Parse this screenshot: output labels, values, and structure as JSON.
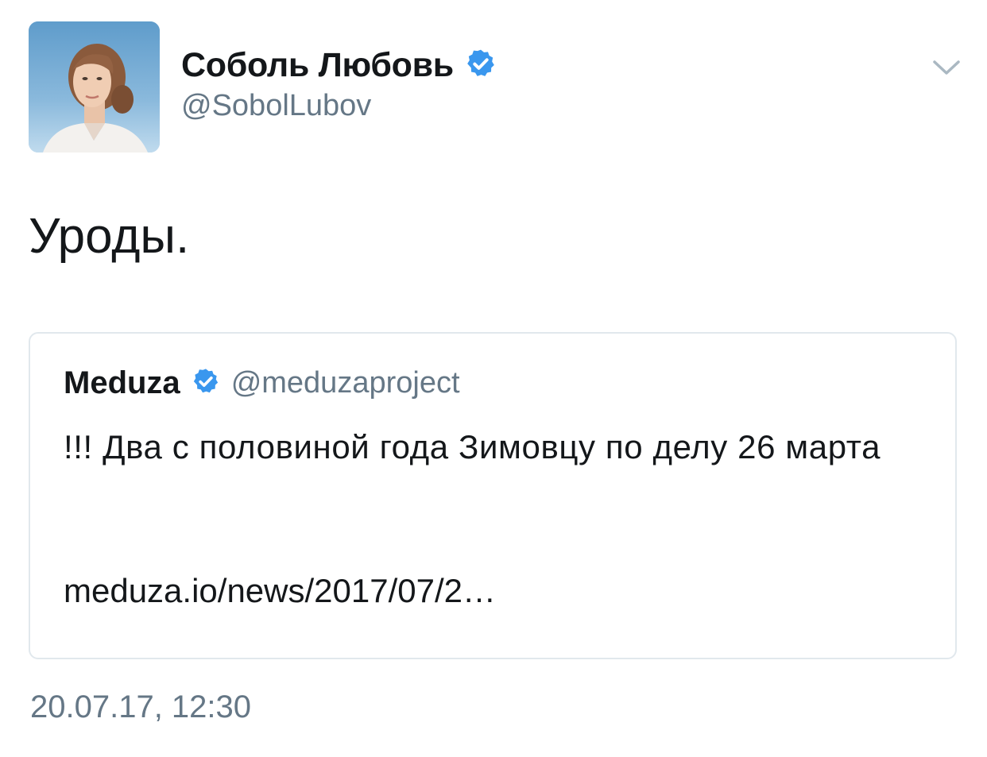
{
  "author": {
    "display_name": "Соболь Любовь",
    "handle": "@SobolLubov",
    "verified": true,
    "avatar_icon": "profile-photo"
  },
  "tweet": {
    "text": "Уроды.",
    "timestamp": "20.07.17, 12:30"
  },
  "quoted_tweet": {
    "display_name": "Meduza",
    "handle": "@meduzaproject",
    "verified": true,
    "text": "!!! Два с половиной года Зимовцу по делу 26 марта",
    "link": "meduza.io/news/2017/07/2…"
  },
  "icons": {
    "verified": "verified-badge-icon",
    "menu": "chevron-down-icon"
  },
  "colors": {
    "verified_blue": "#3a97ee",
    "secondary_text": "#657786",
    "primary_text": "#14171a",
    "card_border": "#e1e8ed"
  }
}
